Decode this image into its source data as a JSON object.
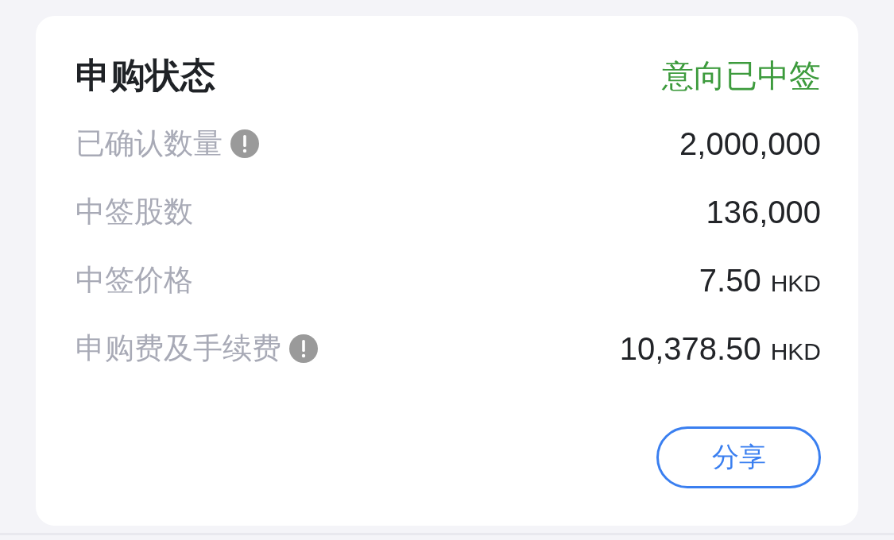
{
  "card": {
    "title": "申购状态",
    "status": {
      "label": "意向已中签",
      "kind": "success"
    },
    "rows": [
      {
        "label": "已确认数量",
        "info": true,
        "value": "2,000,000"
      },
      {
        "label": "中签股数",
        "info": false,
        "value": "136,000"
      },
      {
        "label": "中签价格",
        "info": false,
        "value": "7.50",
        "unit": "HKD"
      },
      {
        "label": "申购费及手续费",
        "info": true,
        "value": "10,378.50",
        "unit": "HKD"
      }
    ],
    "share_button": "分享"
  }
}
